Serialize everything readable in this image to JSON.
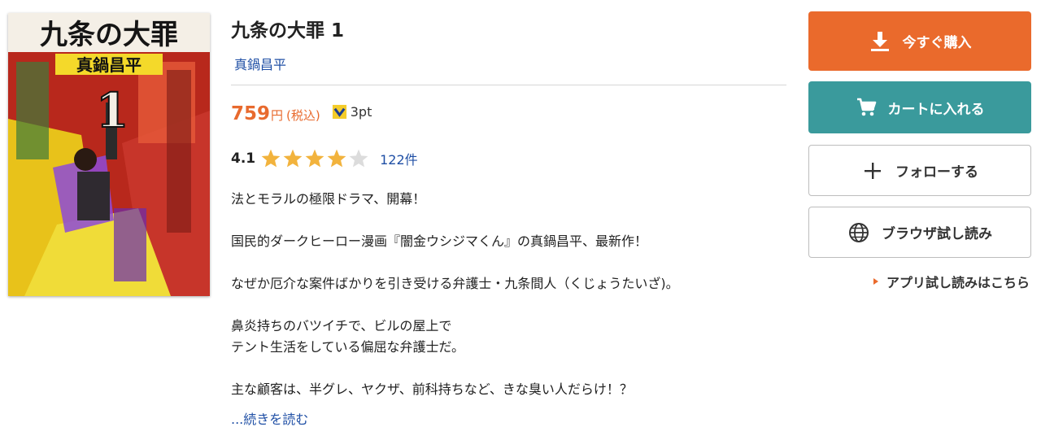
{
  "book": {
    "title": "九条の大罪 1",
    "author": "真鍋昌平",
    "cover": {
      "title_text": "九条の大罪",
      "author_text": "真鍋昌平",
      "volume": "1"
    }
  },
  "price": {
    "amount": "759",
    "unit": "円",
    "tax_note": "(税込)",
    "points": "3pt",
    "points_icon": "points-badge-icon"
  },
  "rating": {
    "value": "4.1",
    "stars_filled": 4,
    "stars_total": 5,
    "review_count": "122件"
  },
  "description": {
    "lines": [
      "法とモラルの極限ドラマ、開幕！",
      "国民的ダークヒーロー漫画『闇金ウシジマくん』の真鍋昌平、最新作！",
      "なぜか厄介な案件ばかりを引き受ける弁護士・九条間人（くじょうたいざ)。",
      "鼻炎持ちのバツイチで、ビルの屋上で",
      "テント生活をしている偏屈な弁護士だ。",
      "主な顧客は、半グレ、ヤクザ、前科持ちなど、きな臭い人だらけ！？"
    ],
    "read_more": "...続きを読む"
  },
  "actions": {
    "buy_label": "今すぐ購入",
    "cart_label": "カートに入れる",
    "follow_label": "フォローする",
    "browse_label": "ブラウザ試し読み",
    "app_link_label": "アプリ試し読みはこちら"
  },
  "colors": {
    "accent_orange": "#ea6a2c",
    "cart_teal": "#3a9a9c",
    "link_blue": "#1f4fa5",
    "star_gold": "#f2b33d",
    "star_empty": "#dcdcdc"
  }
}
